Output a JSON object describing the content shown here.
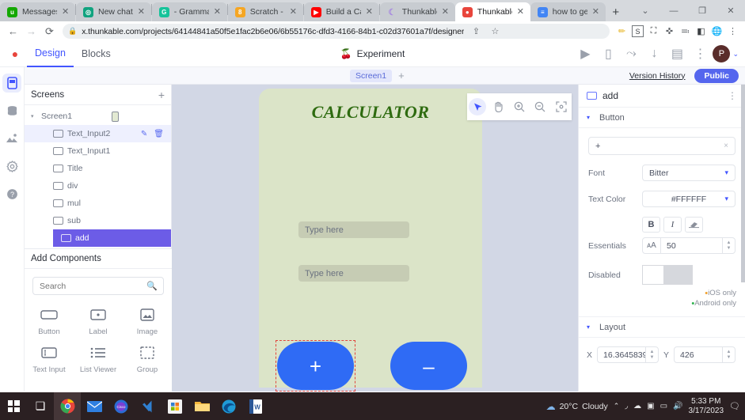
{
  "browser": {
    "tabs": [
      {
        "title": "Messages",
        "favicon": "upwork-icon",
        "color": "#14a800",
        "glyph": "up",
        "active": false
      },
      {
        "title": "New chat",
        "favicon": "chatgpt-icon",
        "color": "#10a37f",
        "glyph": "◎",
        "active": false
      },
      {
        "title": "- Grammarl",
        "favicon": "grammarly-icon",
        "color": "#15c39a",
        "glyph": "G",
        "active": false
      },
      {
        "title": "Scratch - In",
        "favicon": "scratch-icon",
        "color": "#f5a623",
        "glyph": "8",
        "active": false
      },
      {
        "title": "Build a Calc",
        "favicon": "youtube-icon",
        "color": "#ff0000",
        "glyph": "▶",
        "active": false
      },
      {
        "title": "Thunkable",
        "favicon": "thunkable-moon-icon",
        "color": "#a88ae0",
        "glyph": "C",
        "active": false
      },
      {
        "title": "Thunkable",
        "favicon": "thunkable-icon",
        "color": "#e8453c",
        "glyph": "●",
        "active": true
      },
      {
        "title": "how to get",
        "favicon": "docs-icon",
        "color": "#4285f4",
        "glyph": "≡",
        "active": false
      }
    ],
    "new_tab_label": "+",
    "window_controls": [
      "⌄",
      "—",
      "❐",
      "✕"
    ],
    "back_label": "←",
    "forward_label": "→",
    "reload_label": "⟳",
    "lock_label": "🔒",
    "url": "x.thunkable.com/projects/64144841a50f5e1fac2b6e06/6b55176c-dfd3-4166-84b1-c02d37601a7f/designer",
    "share_icon": "share-page-icon",
    "bookmark_icon": "star-icon",
    "extensions": [
      {
        "name": "pencil-extension-icon",
        "glyph": "✏",
        "color": "#e8b72a"
      },
      {
        "name": "s-extension-icon",
        "glyph": "S",
        "color": "#3c4043"
      },
      {
        "name": "capture-extension-icon",
        "glyph": "⛶",
        "color": "#3c4043"
      },
      {
        "name": "puzzle-extensions-icon",
        "glyph": "✚",
        "color": "#5f6368"
      },
      {
        "name": "playlist-extension-icon",
        "glyph": "≕",
        "color": "#5f6368"
      },
      {
        "name": "sidebar-extension-icon",
        "glyph": "◧",
        "color": "#3c4043"
      },
      {
        "name": "globe-extension-icon",
        "glyph": "🌐",
        "color": "#1a73e8"
      },
      {
        "name": "chrome-menu-icon",
        "glyph": "⋮",
        "color": "#5f6368"
      }
    ]
  },
  "app": {
    "logo_icon": "thunkable-logo-icon",
    "tabs": [
      {
        "label": "Design",
        "active": true
      },
      {
        "label": "Blocks",
        "active": false
      }
    ],
    "project_name": "Experiment",
    "project_icon": "thunkable-project-icon",
    "toolbar_icons": [
      {
        "name": "play-icon",
        "glyph": "▶"
      },
      {
        "name": "phone-preview-icon",
        "glyph": "▯"
      },
      {
        "name": "share-icon",
        "glyph": "⤳"
      },
      {
        "name": "download-icon",
        "glyph": "↓"
      },
      {
        "name": "docs-book-icon",
        "glyph": "▤"
      },
      {
        "name": "more-kebab-icon",
        "glyph": "⋮"
      }
    ],
    "avatar_initial": "P",
    "avatar_caret": "⌄"
  },
  "screenbar": {
    "screen_tab": "Screen1",
    "add_screen": "+",
    "version_history": "Version History",
    "publish_label": "Public"
  },
  "rail": [
    {
      "name": "design-rail-icon",
      "glyph": "▯",
      "active": true
    },
    {
      "name": "data-rail-icon",
      "glyph": "▤",
      "active": false
    },
    {
      "name": "assets-rail-icon",
      "glyph": "▲",
      "active": false
    },
    {
      "name": "settings-rail-icon",
      "glyph": "⚙",
      "active": false
    },
    {
      "name": "help-rail-icon",
      "glyph": "?",
      "active": false
    }
  ],
  "screens_panel": {
    "title": "Screens",
    "add_label": "+",
    "root": {
      "label": "Screen1",
      "triangle": "▾"
    },
    "items": [
      {
        "label": "Text_Input2",
        "selected_light": true,
        "selected": false,
        "edit": "✎",
        "delete": "🗑"
      },
      {
        "label": "Text_Input1",
        "selected_light": false,
        "selected": false
      },
      {
        "label": "Title",
        "selected_light": false,
        "selected": false
      },
      {
        "label": "div",
        "selected_light": false,
        "selected": false
      },
      {
        "label": "mul",
        "selected_light": false,
        "selected": false
      },
      {
        "label": "sub",
        "selected_light": false,
        "selected": false
      },
      {
        "label": "add",
        "selected_light": false,
        "selected": true
      }
    ]
  },
  "add_components": {
    "title": "Add Components",
    "search_placeholder": "Search",
    "search_value": "",
    "search_icon": "search-icon",
    "items": [
      {
        "label": "Button",
        "icon": "button-component-icon"
      },
      {
        "label": "Label",
        "icon": "label-component-icon"
      },
      {
        "label": "Image",
        "icon": "image-component-icon"
      },
      {
        "label": "Text Input",
        "icon": "text-input-component-icon"
      },
      {
        "label": "List Viewer",
        "icon": "list-viewer-component-icon"
      },
      {
        "label": "Group",
        "icon": "group-component-icon"
      }
    ]
  },
  "canvas": {
    "phone_bg_color": "#dbe4c8",
    "title_text": "CALCULATOR",
    "title_color": "#2e6b10",
    "input1_placeholder": "Type here",
    "input2_placeholder": "Type here",
    "buttons": [
      {
        "symbol": "+",
        "name": "add-button",
        "selected": true,
        "color": "#2f6bf5"
      },
      {
        "symbol": "–",
        "name": "subtract-button",
        "selected": false,
        "color": "#2f6bf5"
      }
    ],
    "tools": [
      {
        "name": "cursor-tool-icon",
        "glyph": "➤",
        "active": true
      },
      {
        "name": "hand-tool-icon",
        "glyph": "✋",
        "active": false
      },
      {
        "name": "zoom-in-tool-icon",
        "glyph": "⊕",
        "active": false
      },
      {
        "name": "zoom-out-tool-icon",
        "glyph": "⊖",
        "active": false
      },
      {
        "name": "fit-screen-tool-icon",
        "glyph": "⛶",
        "active": false
      }
    ]
  },
  "properties": {
    "component_name": "add",
    "component_icon": "button-component-icon",
    "kebab": "⋮",
    "section_button": "Button",
    "text_value": "+",
    "text_clear": "×",
    "font_label": "Font",
    "font_value": "Bitter",
    "text_color_label": "Text Color",
    "text_color_value": "#FFFFFF",
    "essentials_label": "Essentials",
    "style_buttons": [
      {
        "name": "bold-button",
        "glyph": "B"
      },
      {
        "name": "italic-button",
        "glyph": "I"
      },
      {
        "name": "strikethrough-button",
        "glyph": "S̶"
      }
    ],
    "font_size_icon": "font-size-icon",
    "font_size_value": "50",
    "disabled_label": "Disabled",
    "disabled_state": "off",
    "ios_only": "iOS only",
    "android_only": "Android only",
    "ios_dot_color": "#f0a02a",
    "android_dot_color": "#2cb24c",
    "section_layout": "Layout",
    "x_label": "X",
    "x_value": "16.3645839",
    "y_label": "Y",
    "y_value": "426"
  },
  "taskbar": {
    "items": [
      {
        "name": "start-button-icon",
        "glyph": "",
        "color": "#ffffff"
      },
      {
        "name": "task-view-icon",
        "glyph": "❏",
        "color": "#ffffff"
      },
      {
        "name": "chrome-taskbar-icon",
        "glyph": "◉",
        "color": "#4285f4",
        "highlighted": true
      },
      {
        "name": "mail-taskbar-icon",
        "glyph": "✉",
        "color": "#2f7fe0"
      },
      {
        "name": "cisco-webex-taskbar-icon",
        "glyph": "◍",
        "color": "#2b6cd4"
      },
      {
        "name": "vscode-taskbar-icon",
        "glyph": "✂",
        "color": "#2f7fd0"
      },
      {
        "name": "microsoft-store-taskbar-icon",
        "glyph": "▣",
        "color": "#f2f2f2"
      },
      {
        "name": "file-explorer-taskbar-icon",
        "glyph": "🗀",
        "color": "#f6b73c"
      },
      {
        "name": "edge-taskbar-icon",
        "glyph": "◐",
        "color": "#1f9ad6"
      },
      {
        "name": "word-taskbar-icon",
        "glyph": "W",
        "color": "#2b5797"
      }
    ],
    "weather_icon": "cloud-icon",
    "weather_temp": "20°C",
    "weather_desc": "Cloudy",
    "tray": [
      {
        "name": "tray-chevron-icon",
        "glyph": "⌃"
      },
      {
        "name": "wifi-icon",
        "glyph": "📶"
      },
      {
        "name": "onedrive-icon",
        "glyph": "☁"
      },
      {
        "name": "app-tray-icon",
        "glyph": "▣"
      },
      {
        "name": "battery-icon",
        "glyph": "▭"
      },
      {
        "name": "volume-icon",
        "glyph": "🔊"
      }
    ],
    "time": "5:33 PM",
    "date": "3/17/2023",
    "notification_icon": "notification-icon"
  }
}
